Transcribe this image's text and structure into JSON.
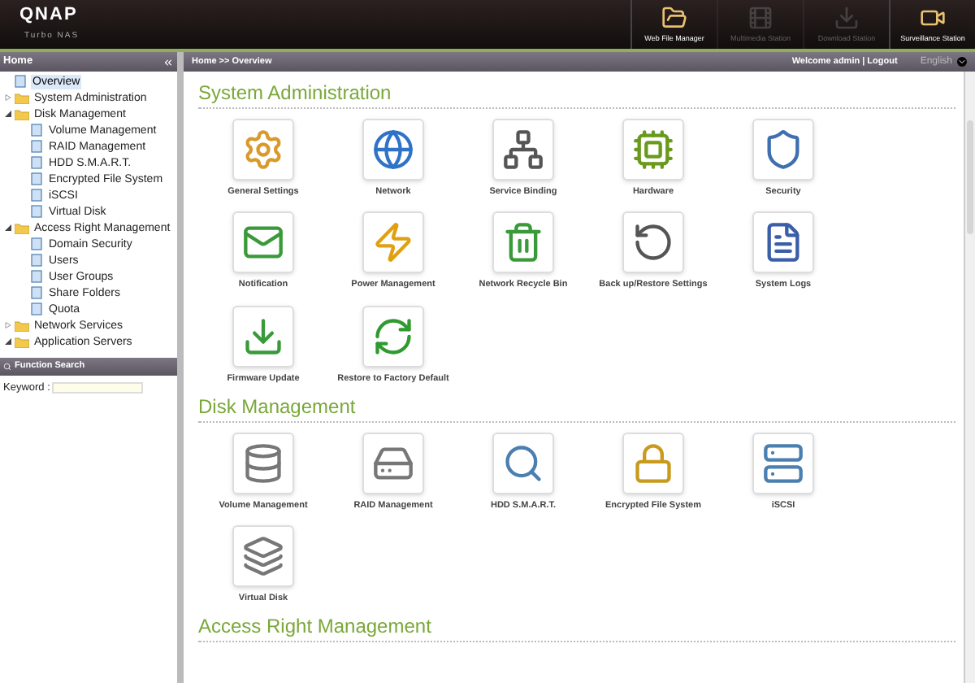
{
  "header": {
    "brand": "QNAP",
    "subtitle": "Turbo NAS",
    "stations": [
      {
        "label": "Web File Manager",
        "disabled": false
      },
      {
        "label": "Multimedia Station",
        "disabled": true
      },
      {
        "label": "Download Station",
        "disabled": true
      },
      {
        "label": "Surveillance Station",
        "disabled": false
      }
    ]
  },
  "sidebar": {
    "title": "Home",
    "tree": [
      {
        "label": "Overview",
        "kind": "page",
        "selected": true
      },
      {
        "label": "System Administration",
        "kind": "folder",
        "expanded": false,
        "selected": false
      },
      {
        "label": "Disk Management",
        "kind": "folder",
        "expanded": true,
        "selected": false,
        "children": [
          {
            "label": "Volume Management",
            "kind": "page",
            "selected": false
          },
          {
            "label": "RAID Management",
            "kind": "page",
            "selected": false
          },
          {
            "label": "HDD S.M.A.R.T.",
            "kind": "page",
            "selected": false
          },
          {
            "label": "Encrypted File System",
            "kind": "page",
            "selected": false
          },
          {
            "label": "iSCSI",
            "kind": "page",
            "selected": false
          },
          {
            "label": "Virtual Disk",
            "kind": "page",
            "selected": false
          }
        ]
      },
      {
        "label": "Access Right Management",
        "kind": "folder",
        "expanded": true,
        "selected": false,
        "children": [
          {
            "label": "Domain Security",
            "kind": "page",
            "selected": false
          },
          {
            "label": "Users",
            "kind": "page",
            "selected": false
          },
          {
            "label": "User Groups",
            "kind": "page",
            "selected": false
          },
          {
            "label": "Share Folders",
            "kind": "page",
            "selected": false
          },
          {
            "label": "Quota",
            "kind": "page",
            "selected": false
          }
        ]
      },
      {
        "label": "Network Services",
        "kind": "folder",
        "expanded": false,
        "selected": false
      },
      {
        "label": "Application Servers",
        "kind": "folder",
        "expanded": true,
        "selected": false
      }
    ],
    "search": {
      "title": "Function Search",
      "label": "Keyword :"
    }
  },
  "topbar": {
    "breadcrumb": "Home >> Overview",
    "welcome": "Welcome admin | Logout",
    "language": "English"
  },
  "sections": [
    {
      "title": "System Administration",
      "items": [
        "General Settings",
        "Network",
        "Service Binding",
        "Hardware",
        "Security",
        "Notification",
        "Power Management",
        "Network Recycle Bin",
        "Back up/Restore Settings",
        "System Logs",
        "Firmware Update",
        "Restore to Factory Default"
      ]
    },
    {
      "title": "Disk Management",
      "items": [
        "Volume Management",
        "RAID Management",
        "HDD S.M.A.R.T.",
        "Encrypted File System",
        "iSCSI",
        "Virtual Disk"
      ]
    },
    {
      "title": "Access Right Management"
    }
  ]
}
